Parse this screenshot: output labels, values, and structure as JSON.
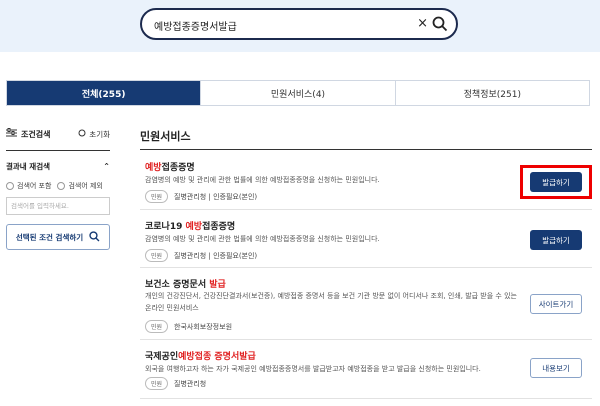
{
  "search": {
    "query": "예방접종증명서발급"
  },
  "tabs": [
    {
      "label": "전체(255)"
    },
    {
      "label": "민원서비스(4)"
    },
    {
      "label": "정책정보(251)"
    }
  ],
  "sidebar": {
    "title": "조건검색",
    "reset": "초기화",
    "refine_title": "결과내 재검색",
    "opt_include": "검색어 포함",
    "opt_exclude": "검색어 제외",
    "input_placeholder": "검색어를 입력하세요.",
    "search_button": "선택된 조건 검색하기"
  },
  "main": {
    "title": "민원서비스",
    "items": [
      {
        "title_hl": "예방",
        "title_rest": "접종증명",
        "desc": "감염병의 예방 및 관리에 관한 법률에 의한 예방접종증명을 신청하는 민원입니다.",
        "pill": "민원",
        "org": "질병관리청",
        "auth": "인증필요(본인)",
        "button": "발급하기"
      },
      {
        "title_pre": "코로나19 ",
        "title_hl": "예방",
        "title_rest": "접종증명",
        "desc": "감염병의 예방 및 관리에 관한 법률에 의한 예방접종증명을 신청하는 민원입니다.",
        "pill": "민원",
        "org": "질병관리청",
        "auth": "인증필요(본인)",
        "button": "발급하기"
      },
      {
        "title_pre": "보건소 증명문서 ",
        "title_hl": "발급",
        "desc": "개인의 건강진단서, 건강진단결과서(보건증), 예방접종 증명서 등을 보건 기관 방문 없이 어디서나 조회, 인쇄, 발급 받을 수 있는 온라인 민원서비스",
        "pill": "민원",
        "org": "한국사회보장정보원",
        "button": "사이트가기"
      },
      {
        "title_pre": "국제공인",
        "title_hl": "예방접종 증명서발급",
        "desc": "외국을 여행하고자 하는 자가 국제공인 예방접종증명서를 발급받고자 예방접종을 받고 발급을 신청하는 민원입니다.",
        "pill": "민원",
        "org": "질병관리청",
        "button": "내용보기"
      }
    ]
  },
  "colors": {
    "primary": "#163a73",
    "highlight": "#e02020",
    "hero_bg": "#eaf2fb"
  }
}
